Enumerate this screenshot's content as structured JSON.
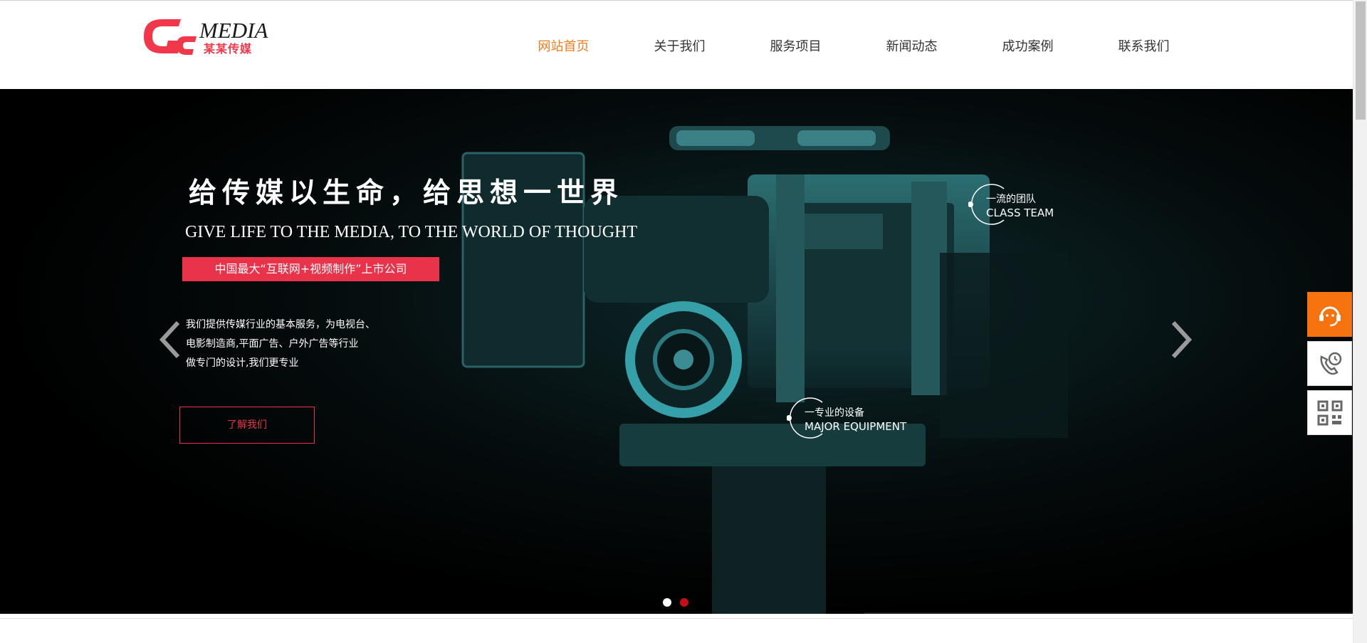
{
  "brand": {
    "word": "MEDIA",
    "sub": "某某传媒",
    "accent": "#f0384a"
  },
  "nav": {
    "items": [
      {
        "label": "网站首页",
        "active": true
      },
      {
        "label": "关于我们",
        "active": false
      },
      {
        "label": "服务项目",
        "active": false
      },
      {
        "label": "新闻动态",
        "active": false
      },
      {
        "label": "成功案例",
        "active": false
      },
      {
        "label": "联系我们",
        "active": false
      }
    ],
    "active_color": "#ef7d22"
  },
  "hero": {
    "title_cn": "给传媒以生命，给思想一世界",
    "title_en": "GIVE LIFE TO THE MEDIA, TO THE WORLD OF THOUGHT",
    "badge": "中国最大“互联网+视频制作”上市公司",
    "desc_lines": [
      "我们提供传媒行业的基本服务，为电视台、",
      "电影制造商,平面广告、户外广告等行业",
      "做专门的设计,我们更专业"
    ],
    "button": "了解我们",
    "hotspots": [
      {
        "cn": "一流的团队",
        "en": "CLASS TEAM"
      },
      {
        "cn": "一专业的设备",
        "en": "MAJOR EQUIPMENT"
      }
    ],
    "slides_total": 2,
    "slide_active": 2
  },
  "side": {
    "items": [
      {
        "icon": "customer-service-icon"
      },
      {
        "icon": "phone-clock-icon"
      },
      {
        "icon": "qr-code-icon"
      }
    ]
  }
}
